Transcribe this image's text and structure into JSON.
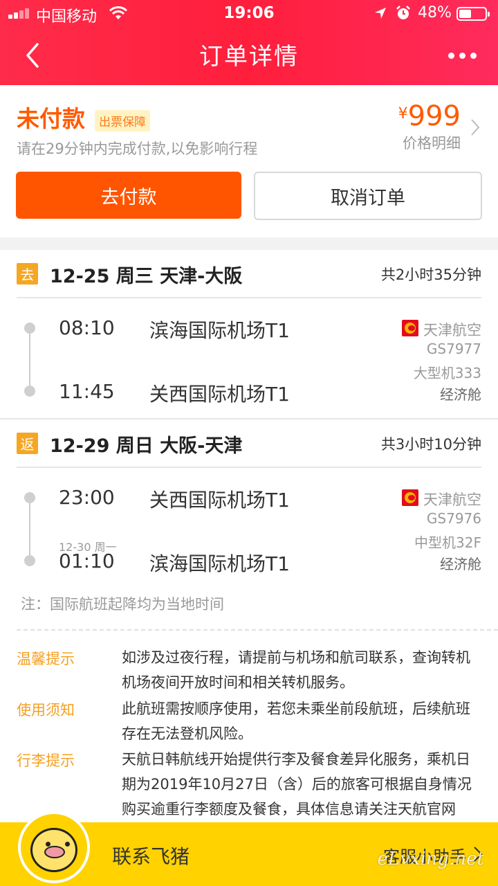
{
  "status_bar": {
    "carrier": "中国移动",
    "time": "19:06",
    "battery_pct": "48%",
    "battery_level": 0.48
  },
  "nav": {
    "title": "订单详情",
    "back_icon": "chevron-left-icon",
    "more_icon": "more-dots-icon"
  },
  "order": {
    "status": "未付款",
    "badge": "出票保障",
    "hint": "请在29分钟内完成付款,以免影响行程",
    "currency": "¥",
    "price": "999",
    "price_detail": "价格明细",
    "pay_label": "去付款",
    "cancel_label": "取消订单"
  },
  "legs": [
    {
      "tag": "去",
      "title": "12-25 周三 天津-大阪",
      "duration": "共2小时35分钟",
      "dep_time": "08:10",
      "dep_airport": "滨海国际机场T1",
      "arr_date": "",
      "arr_time": "11:45",
      "arr_airport": "关西国际机场T1",
      "airline": "天津航空",
      "flight_no": "GS7977",
      "aircraft": "大型机333",
      "cabin": "经济舱"
    },
    {
      "tag": "返",
      "title": "12-29 周日 大阪-天津",
      "duration": "共3小时10分钟",
      "dep_time": "23:00",
      "dep_airport": "关西国际机场T1",
      "arr_date": "12-30 周一",
      "arr_time": "01:10",
      "arr_airport": "滨海国际机场T1",
      "airline": "天津航空",
      "flight_no": "GS7976",
      "aircraft": "中型机32F",
      "cabin": "经济舱"
    }
  ],
  "note": "注：国际航班起降均为当地时间",
  "tips": [
    {
      "label": "温馨提示",
      "text": "如涉及过夜行程，请提前与机场和航司联系，查询转机机场夜间开放时间和相关转机服务。"
    },
    {
      "label": "使用须知",
      "text": "此航班需按顺序使用，若您未乘坐前段航班，后续航班存在无法登机风险。"
    },
    {
      "label": "行李提示",
      "text": "天航日韩航线开始提供行李及餐食差异化服务，乘机日期为2019年10月27日（含）后的旅客可根据自身情况购买逾重行李额度及餐食，具体信息请关注天航官网"
    }
  ],
  "bottom": {
    "contact": "联系飞猪",
    "assistant": "客服小助手",
    "watermark": "eLvxing.net"
  },
  "colors": {
    "header": "#ff2348",
    "accent": "#ff5500",
    "tip_label": "#f5a020",
    "bottom_bar": "#ffd200"
  }
}
